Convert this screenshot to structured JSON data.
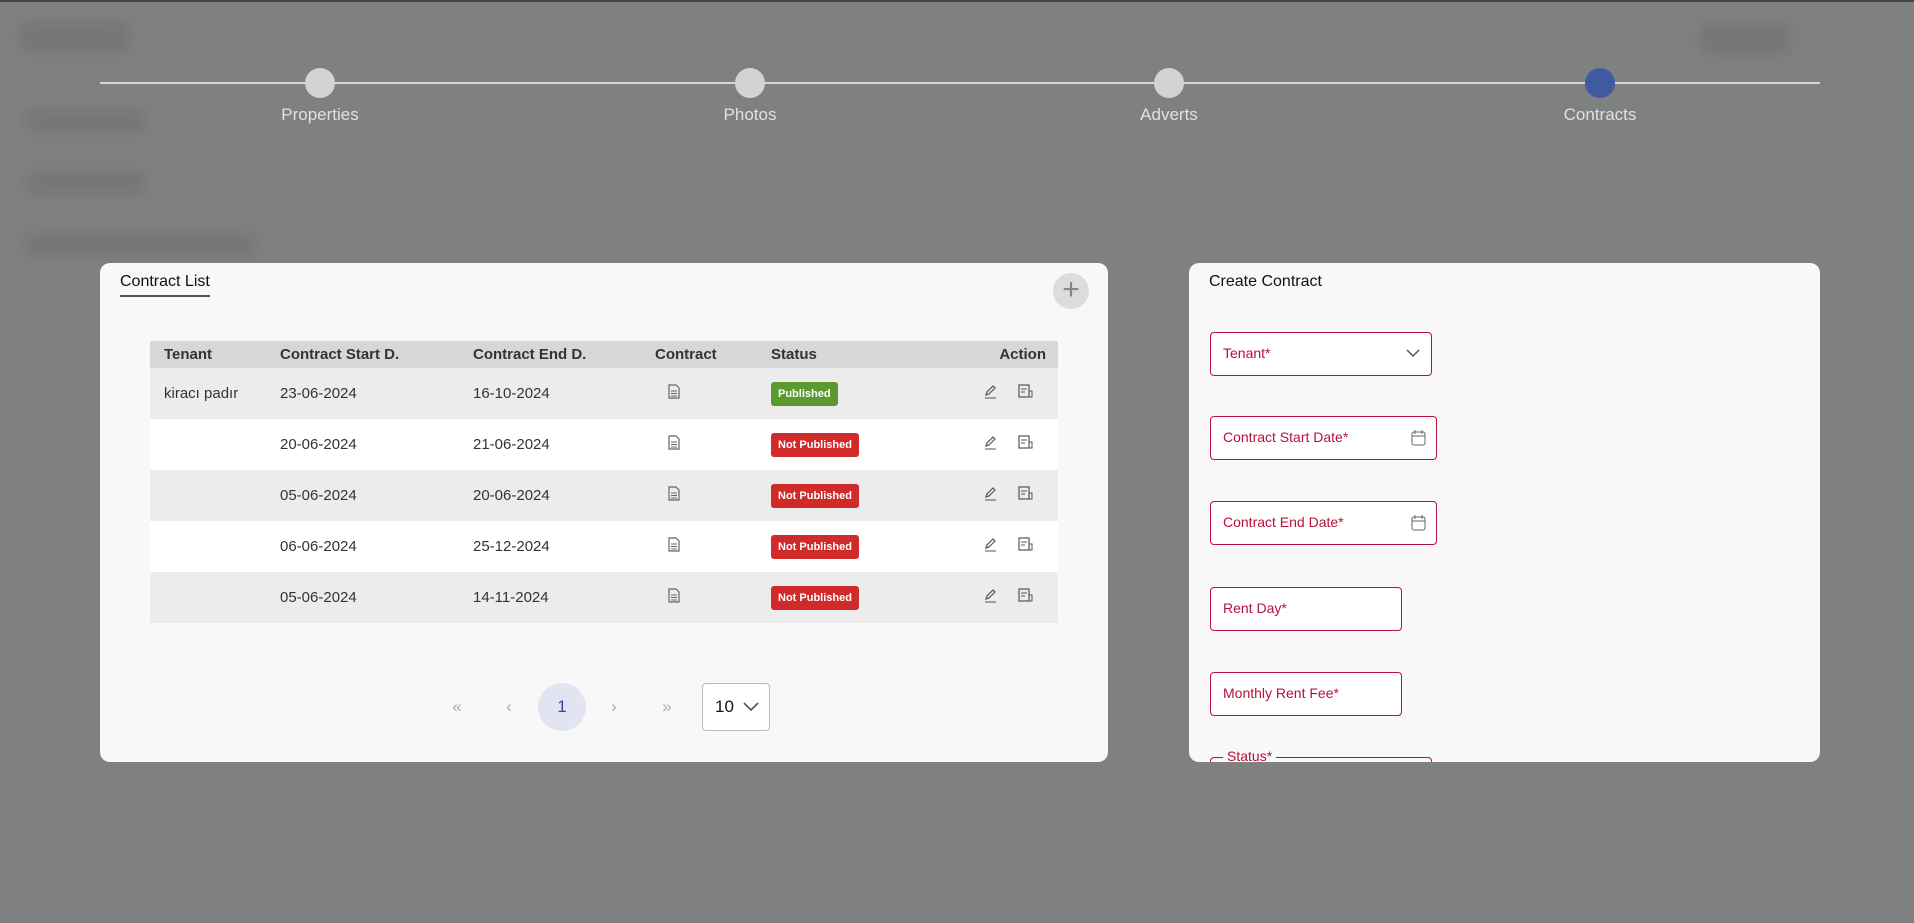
{
  "stepper": {
    "steps": [
      {
        "label": "Properties",
        "active": false
      },
      {
        "label": "Photos",
        "active": false
      },
      {
        "label": "Adverts",
        "active": false
      },
      {
        "label": "Contracts",
        "active": true
      }
    ]
  },
  "contract_list": {
    "title": "Contract List",
    "add_icon": "plus-icon",
    "columns": [
      "Tenant",
      "Contract Start D.",
      "Contract End D.",
      "Contract",
      "Status",
      "Action"
    ],
    "rows": [
      {
        "tenant": "kiracı padır",
        "start": "23-06-2024",
        "end": "16-10-2024",
        "status": "Published"
      },
      {
        "tenant": "",
        "start": "20-06-2024",
        "end": "21-06-2024",
        "status": "Not Published"
      },
      {
        "tenant": "",
        "start": "05-06-2024",
        "end": "20-06-2024",
        "status": "Not Published"
      },
      {
        "tenant": "",
        "start": "06-06-2024",
        "end": "25-12-2024",
        "status": "Not Published"
      },
      {
        "tenant": "",
        "start": "05-06-2024",
        "end": "14-11-2024",
        "status": "Not Published"
      }
    ],
    "pagination": {
      "first": "«",
      "prev": "‹",
      "current": "1",
      "next": "›",
      "last": "»",
      "page_size": "10"
    }
  },
  "create_contract": {
    "title": "Create Contract",
    "fields": {
      "tenant": "Tenant*",
      "start_date": "Contract Start Date*",
      "end_date": "Contract End Date*",
      "rent_day": "Rent Day*",
      "monthly_fee": "Monthly Rent Fee*",
      "status": "Status*"
    }
  },
  "colors": {
    "accent": "#3f5aa0",
    "published": "#5b9a30",
    "not_published": "#d12a2a",
    "field_error": "#b5123a"
  }
}
